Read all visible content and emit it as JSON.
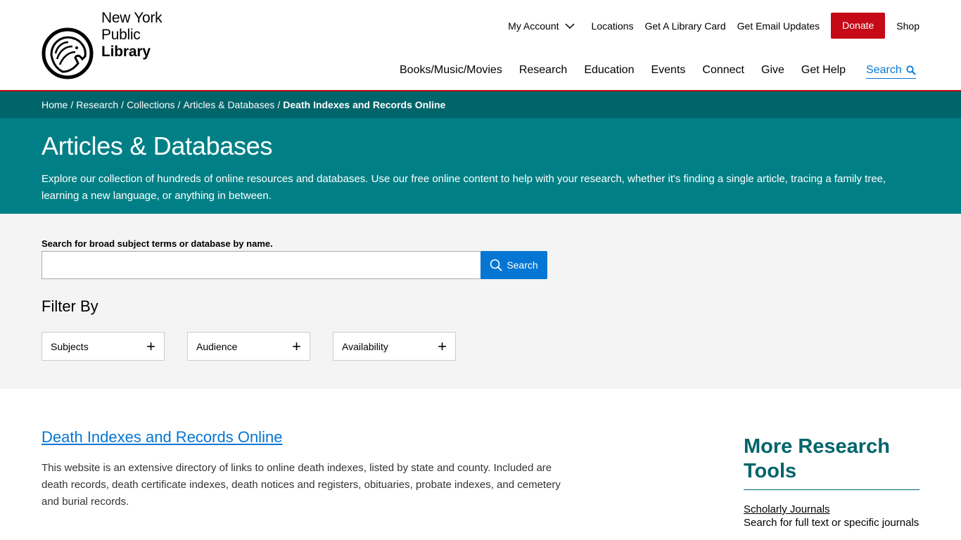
{
  "logo": {
    "line1": "New York",
    "line2": "Public",
    "line3": "Library"
  },
  "util_nav": {
    "my_account": "My Account",
    "locations": "Locations",
    "library_card": "Get A Library Card",
    "email_updates": "Get Email Updates",
    "donate": "Donate",
    "shop": "Shop"
  },
  "main_nav": {
    "items": [
      "Books/Music/Movies",
      "Research",
      "Education",
      "Events",
      "Connect",
      "Give",
      "Get Help"
    ],
    "search": "Search"
  },
  "breadcrumb": {
    "items": [
      "Home",
      "Research",
      "Collections",
      "Articles & Databases"
    ],
    "current": "Death Indexes and Records Online"
  },
  "hero": {
    "title": "Articles & Databases",
    "description": "Explore our collection of hundreds of online resources and databases. Use our free online content to help with your research, whether it's finding a single article, tracing a family tree, learning a new language, or anything in between."
  },
  "search": {
    "label": "Search for broad subject terms or database by name.",
    "value": "",
    "button": "Search"
  },
  "filters": {
    "title": "Filter By",
    "items": [
      "Subjects",
      "Audience",
      "Availability"
    ]
  },
  "result": {
    "title": "Death Indexes and Records Online",
    "description": "This website is an extensive directory of links to online death indexes, listed by state and county. Included are death records, death certificate indexes, death notices and registers, obituaries, probate indexes, and cemetery and burial records."
  },
  "sidebar": {
    "title": "More Research Tools",
    "link": "Scholarly Journals",
    "link_desc": "Search for full text or specific journals"
  },
  "colors": {
    "brand_red": "#c60917",
    "teal_dark": "#00646b",
    "teal": "#008086",
    "link_blue": "#0576d3"
  }
}
